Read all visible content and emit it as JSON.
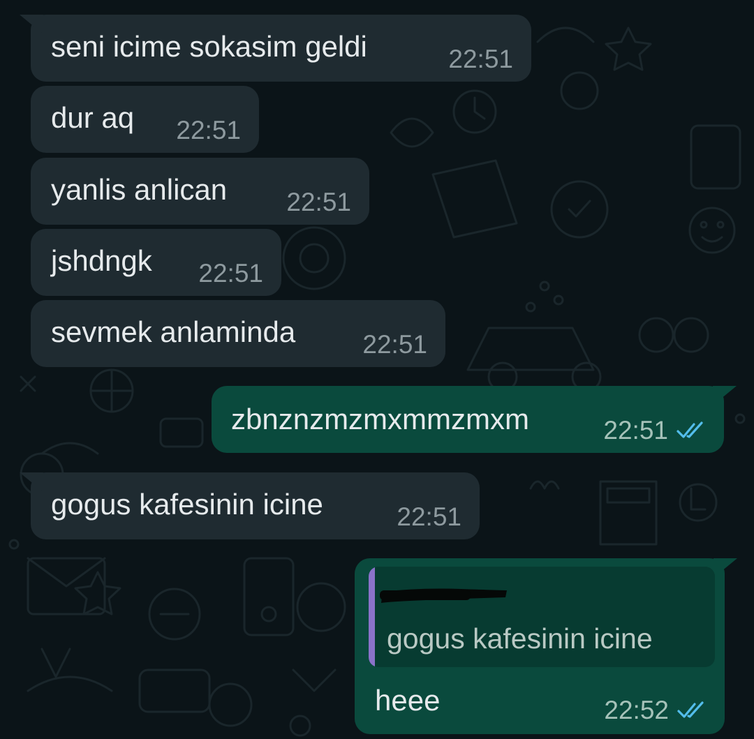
{
  "theme": {
    "background": "#0b1418",
    "incoming_bubble": "#1f2b31",
    "outgoing_bubble": "#0a4a3d",
    "read_ticks": "#53bdeb",
    "quote_bar": "#8a72c9"
  },
  "messages": [
    {
      "direction": "incoming",
      "text": "seni icime sokasim geldi",
      "time": "22:51"
    },
    {
      "direction": "incoming",
      "text": "dur aq",
      "time": "22:51"
    },
    {
      "direction": "incoming",
      "text": "yanlis anlican",
      "time": "22:51"
    },
    {
      "direction": "incoming",
      "text": "jshdngk",
      "time": "22:51"
    },
    {
      "direction": "incoming",
      "text": "sevmek anlaminda",
      "time": "22:51"
    },
    {
      "direction": "outgoing",
      "text": "zbnznzmzmxmmzmxm",
      "time": "22:51",
      "status_icon": "double-check-icon"
    },
    {
      "direction": "incoming",
      "text": "gogus kafesinin icine",
      "time": "22:51"
    },
    {
      "direction": "outgoing",
      "reply": {
        "author": "",
        "text": "gogus kafesinin icine"
      },
      "text": "heee",
      "time": "22:52",
      "status_icon": "double-check-icon"
    }
  ]
}
